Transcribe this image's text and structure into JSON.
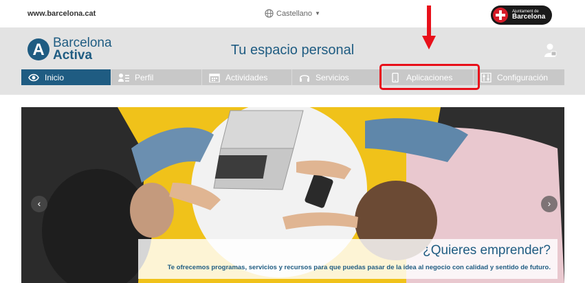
{
  "topbar": {
    "site_link": "www.barcelona.cat",
    "language": "Castellano",
    "ajuntament_small": "Ajuntament de",
    "ajuntament_big": "Barcelona"
  },
  "header": {
    "logo_line1": "Barcelona",
    "logo_line2": "Activa",
    "title": "Tu espacio personal"
  },
  "nav": {
    "items": [
      {
        "label": "Inicio",
        "icon": "eye-icon",
        "active": true
      },
      {
        "label": "Perfil",
        "icon": "profile-card-icon",
        "active": false
      },
      {
        "label": "Actividades",
        "icon": "calendar-icon",
        "active": false
      },
      {
        "label": "Servicios",
        "icon": "headset-icon",
        "active": false
      },
      {
        "label": "Aplicaciones",
        "icon": "mobile-icon",
        "active": false
      },
      {
        "label": "Configuración",
        "icon": "settings-icon",
        "active": false
      }
    ]
  },
  "hero": {
    "heading": "¿Quieres emprender?",
    "text": "Te ofrecemos programas, servicios y recursos para que puedas pasar de la idea al negocio con calidad y sentido de futuro."
  },
  "colors": {
    "brand_blue": "#1f5c82",
    "nav_inactive": "#c8c8c8",
    "highlight_red": "#e8101a",
    "hero_yellow": "#f0c21a"
  }
}
